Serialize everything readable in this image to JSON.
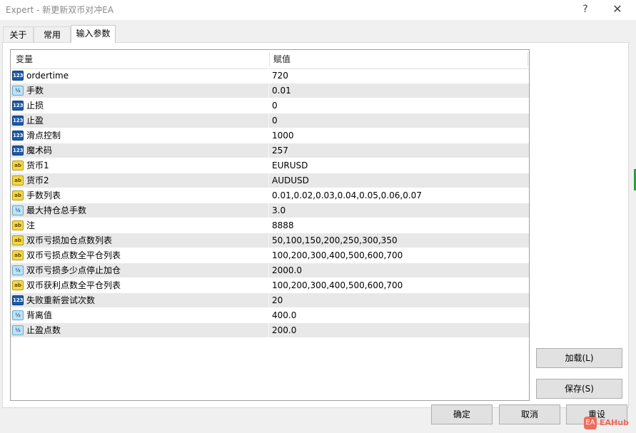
{
  "window": {
    "title": "Expert - 新更新双币对冲EA",
    "help_label": "?",
    "close_label": "✕"
  },
  "tabs": [
    {
      "label": "关于"
    },
    {
      "label": "常用"
    },
    {
      "label": "输入参数"
    }
  ],
  "grid": {
    "columns": {
      "name": "变量",
      "value": "赋值"
    },
    "rows": [
      {
        "type": "int",
        "icon_text": "123",
        "name": "ordertime",
        "value": "720"
      },
      {
        "type": "double",
        "icon_text": "½",
        "name": "手数",
        "value": "0.01"
      },
      {
        "type": "int",
        "icon_text": "123",
        "name": "止损",
        "value": "0"
      },
      {
        "type": "int",
        "icon_text": "123",
        "name": "止盈",
        "value": "0"
      },
      {
        "type": "int",
        "icon_text": "123",
        "name": "滑点控制",
        "value": "1000"
      },
      {
        "type": "int",
        "icon_text": "123",
        "name": "魔术码",
        "value": "257"
      },
      {
        "type": "string",
        "icon_text": "ab",
        "name": "货币1",
        "value": "EURUSD"
      },
      {
        "type": "string",
        "icon_text": "ab",
        "name": "货币2",
        "value": "AUDUSD"
      },
      {
        "type": "string",
        "icon_text": "ab",
        "name": "手数列表",
        "value": "0.01,0.02,0.03,0.04,0.05,0.06,0.07"
      },
      {
        "type": "double",
        "icon_text": "½",
        "name": "最大持仓总手数",
        "value": "3.0"
      },
      {
        "type": "string",
        "icon_text": "ab",
        "name": "注",
        "value": "8888"
      },
      {
        "type": "string",
        "icon_text": "ab",
        "name": "双币亏损加仓点数列表",
        "value": "50,100,150,200,250,300,350"
      },
      {
        "type": "string",
        "icon_text": "ab",
        "name": "双币亏损点数全平仓列表",
        "value": "100,200,300,400,500,600,700"
      },
      {
        "type": "double",
        "icon_text": "½",
        "name": "双币亏损多少点停止加仓",
        "value": "2000.0"
      },
      {
        "type": "string",
        "icon_text": "ab",
        "name": "双币获利点数全平仓列表",
        "value": "100,200,300,400,500,600,700"
      },
      {
        "type": "int",
        "icon_text": "123",
        "name": "失败重新尝试次数",
        "value": "20"
      },
      {
        "type": "double",
        "icon_text": "½",
        "name": "背离值",
        "value": "400.0"
      },
      {
        "type": "double",
        "icon_text": "½",
        "name": "止盈点数",
        "value": "200.0"
      }
    ]
  },
  "buttons": {
    "load": "加载(L)",
    "save": "保存(S)",
    "ok": "确定",
    "cancel": "取消",
    "reset": "重设"
  },
  "watermark": {
    "badge": "EA",
    "text": "EAHub"
  },
  "colors": {
    "int_icon": "#1e5aa8",
    "double_icon": "#bfe3f3",
    "string_icon": "#f2d94a",
    "row_alt": "#e8e8e8"
  }
}
